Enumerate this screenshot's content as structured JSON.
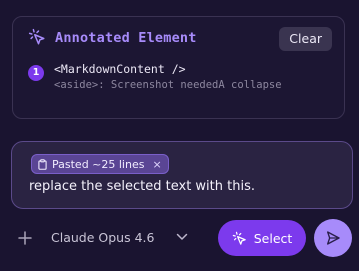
{
  "annotation": {
    "title": "Annotated Element",
    "clear_label": "Clear",
    "items": [
      {
        "index": "1",
        "element": "<MarkdownContent />",
        "note": "<aside>: Screenshot neededA collapse"
      }
    ]
  },
  "composer": {
    "attachment": {
      "label": "Pasted ~25 lines",
      "close": "×"
    },
    "text": "replace the selected text with this."
  },
  "toolbar": {
    "model": "Claude Opus 4.6",
    "select_label": "Select"
  },
  "colors": {
    "accent": "#7c3aed",
    "accent_light": "#a78bfa",
    "background": "#1a1430"
  },
  "icons": {
    "annotate": "cursor-click-icon",
    "chip": "clipboard-icon",
    "add": "plus-icon",
    "model_dropdown": "chevron-down-icon",
    "select": "cursor-click-icon",
    "send": "send-icon"
  }
}
